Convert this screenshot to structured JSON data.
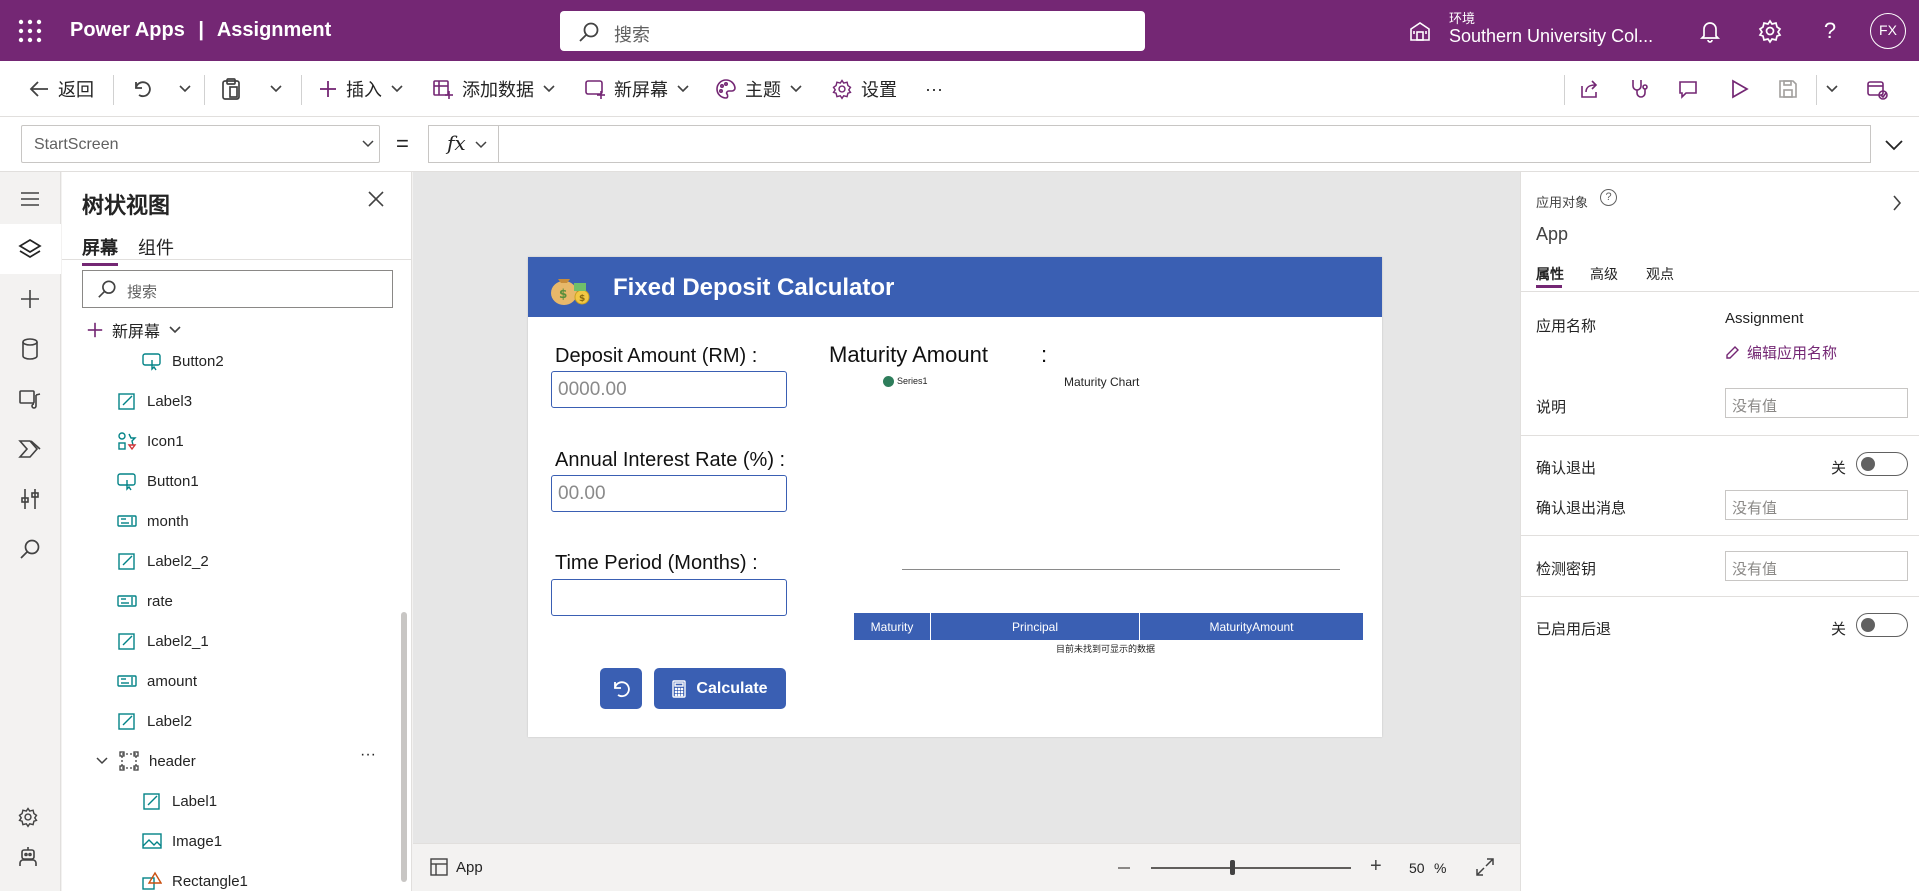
{
  "topbar": {
    "brand": "Power Apps",
    "app_name": "Assignment",
    "search_placeholder": "搜索",
    "env_label": "环境",
    "env_name": "Southern University Col...",
    "avatar_initials": "FX"
  },
  "commands": {
    "back": "返回",
    "insert": "插入",
    "add_data": "添加数据",
    "new_screen": "新屏幕",
    "theme": "主题",
    "settings": "设置",
    "more": "···"
  },
  "formula": {
    "property": "StartScreen",
    "equals": "=",
    "fx": "fx",
    "value": ""
  },
  "tree": {
    "title": "树状视图",
    "tabs": [
      "屏幕",
      "组件"
    ],
    "search_placeholder": "搜索",
    "new_screen": "新屏幕",
    "nodes": [
      "Button2",
      "Label3",
      "Icon1",
      "Button1",
      "month",
      "Label2_2",
      "rate",
      "Label2_1",
      "amount",
      "Label2",
      "header",
      "Label1",
      "Image1",
      "Rectangle1"
    ],
    "more": "···"
  },
  "app": {
    "title": "Fixed Deposit Calculator",
    "deposit_label": "Deposit Amount (RM) :",
    "deposit_placeholder": "0000.00",
    "rate_label": "Annual Interest Rate (%) :",
    "rate_placeholder": "00.00",
    "period_label": "Time Period (Months) :",
    "period_value": "",
    "maturity_label": "Maturity Amount",
    "maturity_colon": ":",
    "chart_legend": "Series1",
    "chart_title": "Maturity Chart",
    "table_headers": [
      "Maturity",
      "Principal",
      "MaturityAmount"
    ],
    "table_empty": "目前未找到可显示的数据",
    "calculate": "Calculate"
  },
  "status": {
    "screen_label": "App",
    "zoom_value": "50",
    "zoom_unit": "%",
    "zoom_level": 0.25
  },
  "props": {
    "object_type": "应用对象",
    "object_name": "App",
    "tabs": [
      "属性",
      "高级",
      "观点"
    ],
    "app_name_label": "应用名称",
    "app_name_value": "Assignment",
    "edit_app_name": "编辑应用名称",
    "description_label": "说明",
    "no_value": "没有值",
    "confirm_exit_label": "确认退出",
    "off": "关",
    "confirm_exit_msg_label": "确认退出消息",
    "detect_key_label": "检测密钥",
    "back_enabled_label": "已启用后退"
  },
  "colors": {
    "header_purple": "#742774",
    "app_blue": "#3a5fb3",
    "legend_green": "#2e7d5b"
  }
}
